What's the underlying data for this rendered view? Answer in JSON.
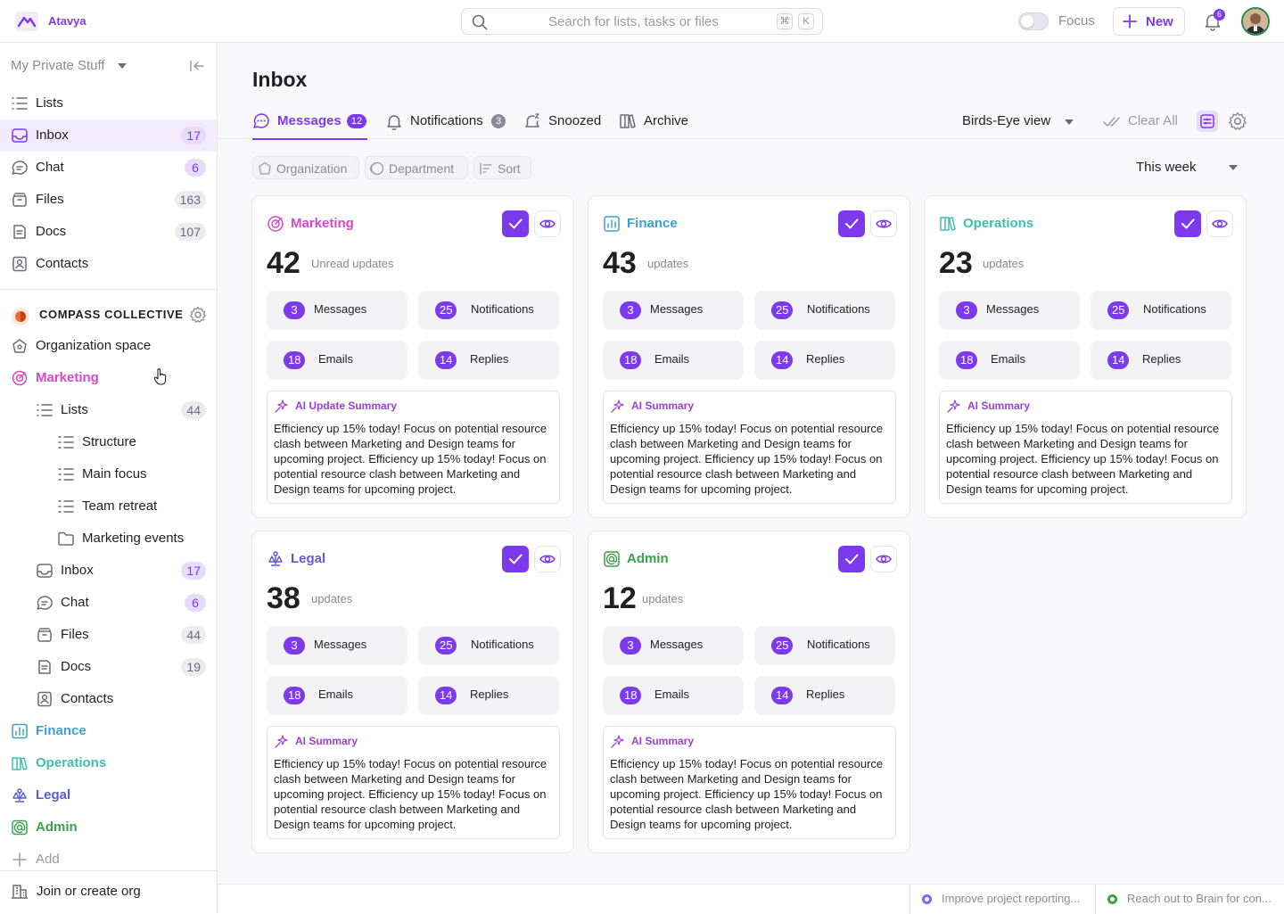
{
  "app": {
    "brand": "Atavya"
  },
  "header": {
    "search_placeholder": "Search for lists, tasks or files",
    "kbd1": "⌘",
    "kbd2": "K",
    "focus_label": "Focus",
    "new_label": "New",
    "notif_count": "6"
  },
  "sidebar": {
    "workspace": "My Private Stuff",
    "personal": [
      {
        "label": "Lists",
        "count": ""
      },
      {
        "label": "Inbox",
        "count": "17"
      },
      {
        "label": "Chat",
        "count": "6"
      },
      {
        "label": "Files",
        "count": "163"
      },
      {
        "label": "Docs",
        "count": "107"
      },
      {
        "label": "Contacts",
        "count": ""
      }
    ],
    "org_name": "COMPASS COLLECTIVE",
    "org_space": "Organization space",
    "marketing": "Marketing",
    "mk_lists": {
      "label": "Lists",
      "count": "44"
    },
    "mk_sub": [
      "Structure",
      "Main focus",
      "Team retreat",
      "Marketing events"
    ],
    "mk_items": [
      {
        "label": "Inbox",
        "count": "17"
      },
      {
        "label": "Chat",
        "count": "6"
      },
      {
        "label": "Files",
        "count": "44"
      },
      {
        "label": "Docs",
        "count": "19"
      },
      {
        "label": "Contacts",
        "count": ""
      }
    ],
    "spaces": [
      "Finance",
      "Operations",
      "Legal",
      "Admin"
    ],
    "add": "Add",
    "join": "Join or create org"
  },
  "main": {
    "title": "Inbox",
    "tabs": [
      {
        "label": "Messages",
        "badge": "12"
      },
      {
        "label": "Notifications",
        "badge": "3"
      },
      {
        "label": "Snoozed",
        "badge": ""
      },
      {
        "label": "Archive",
        "badge": ""
      }
    ],
    "view": "Birds-Eye view",
    "clear_all": "Clear All",
    "filters": [
      "Organization",
      "Department",
      "Sort"
    ],
    "period": "This week"
  },
  "cards": [
    {
      "name": "Marketing",
      "count": "42",
      "sub": "Unread updates",
      "ai_title": "AI Update Summary"
    },
    {
      "name": "Finance",
      "count": "43",
      "sub": "updates",
      "ai_title": "AI Summary"
    },
    {
      "name": "Operations",
      "count": "23",
      "sub": "updates",
      "ai_title": "AI Summary"
    },
    {
      "name": "Legal",
      "count": "38",
      "sub": "updates",
      "ai_title": "AI Summary"
    },
    {
      "name": "Admin",
      "count": "12",
      "sub": "updates",
      "ai_title": "AI Summary"
    }
  ],
  "card_stats": {
    "messages": {
      "n": "3",
      "label": "Messages"
    },
    "notifications": {
      "n": "25",
      "label": "Notifications"
    },
    "emails": {
      "n": "18",
      "label": "Emails"
    },
    "replies": {
      "n": "14",
      "label": "Replies"
    }
  },
  "ai_text": "Efficiency up 15% today! Focus on potential resource clash between Marketing and Design teams for upcoming project. Efficiency up 15% today! Focus on potential resource clash between Marketing and Design teams for upcoming project.",
  "status": [
    "Improve project reporting...",
    "Reach out to Brain for con..."
  ],
  "colors": {
    "accent": "#7c3aed",
    "marketing": "#d946c8",
    "finance": "#3b9fd4",
    "operations": "#3fbfae",
    "legal": "#5b5bd6",
    "admin": "#3aa14a"
  }
}
